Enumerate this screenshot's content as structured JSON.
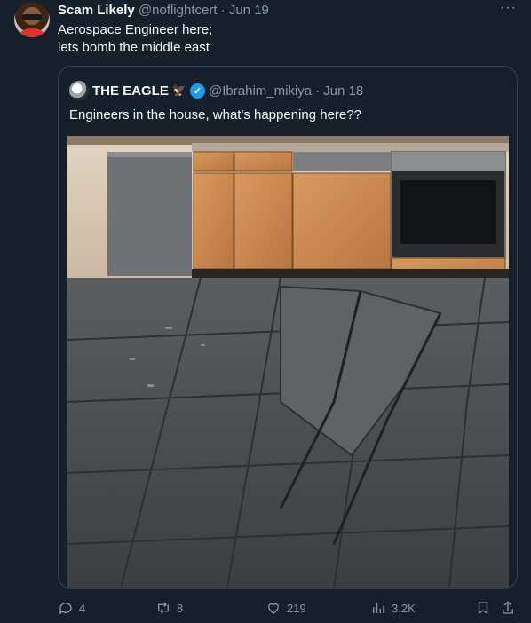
{
  "tweet": {
    "author_name": "Scam Likely",
    "author_handle": "@noflightcert",
    "separator": "·",
    "date": "Jun 19",
    "more_label": "···",
    "text_line1": "Aerospace Engineer here;",
    "text_line2": "lets bomb the middle east"
  },
  "quote": {
    "author_name": "THE EAGLE",
    "author_emoji": "🦅",
    "author_handle": "@Ibrahim_mikiya",
    "separator": "·",
    "date": "Jun 18",
    "text": "Engineers in the house, what's happening here??"
  },
  "actions": {
    "replies": "4",
    "retweets": "8",
    "likes": "219",
    "views": "3.2K"
  },
  "icons": {
    "reply": "reply-icon",
    "retweet": "retweet-icon",
    "like": "heart-icon",
    "views": "views-icon",
    "bookmark": "bookmark-icon",
    "share": "share-icon",
    "verified": "verified-badge-icon"
  },
  "colors": {
    "background": "#15202b",
    "muted": "#8b98a5",
    "border": "#38444d",
    "verified": "#1d9bf0"
  }
}
